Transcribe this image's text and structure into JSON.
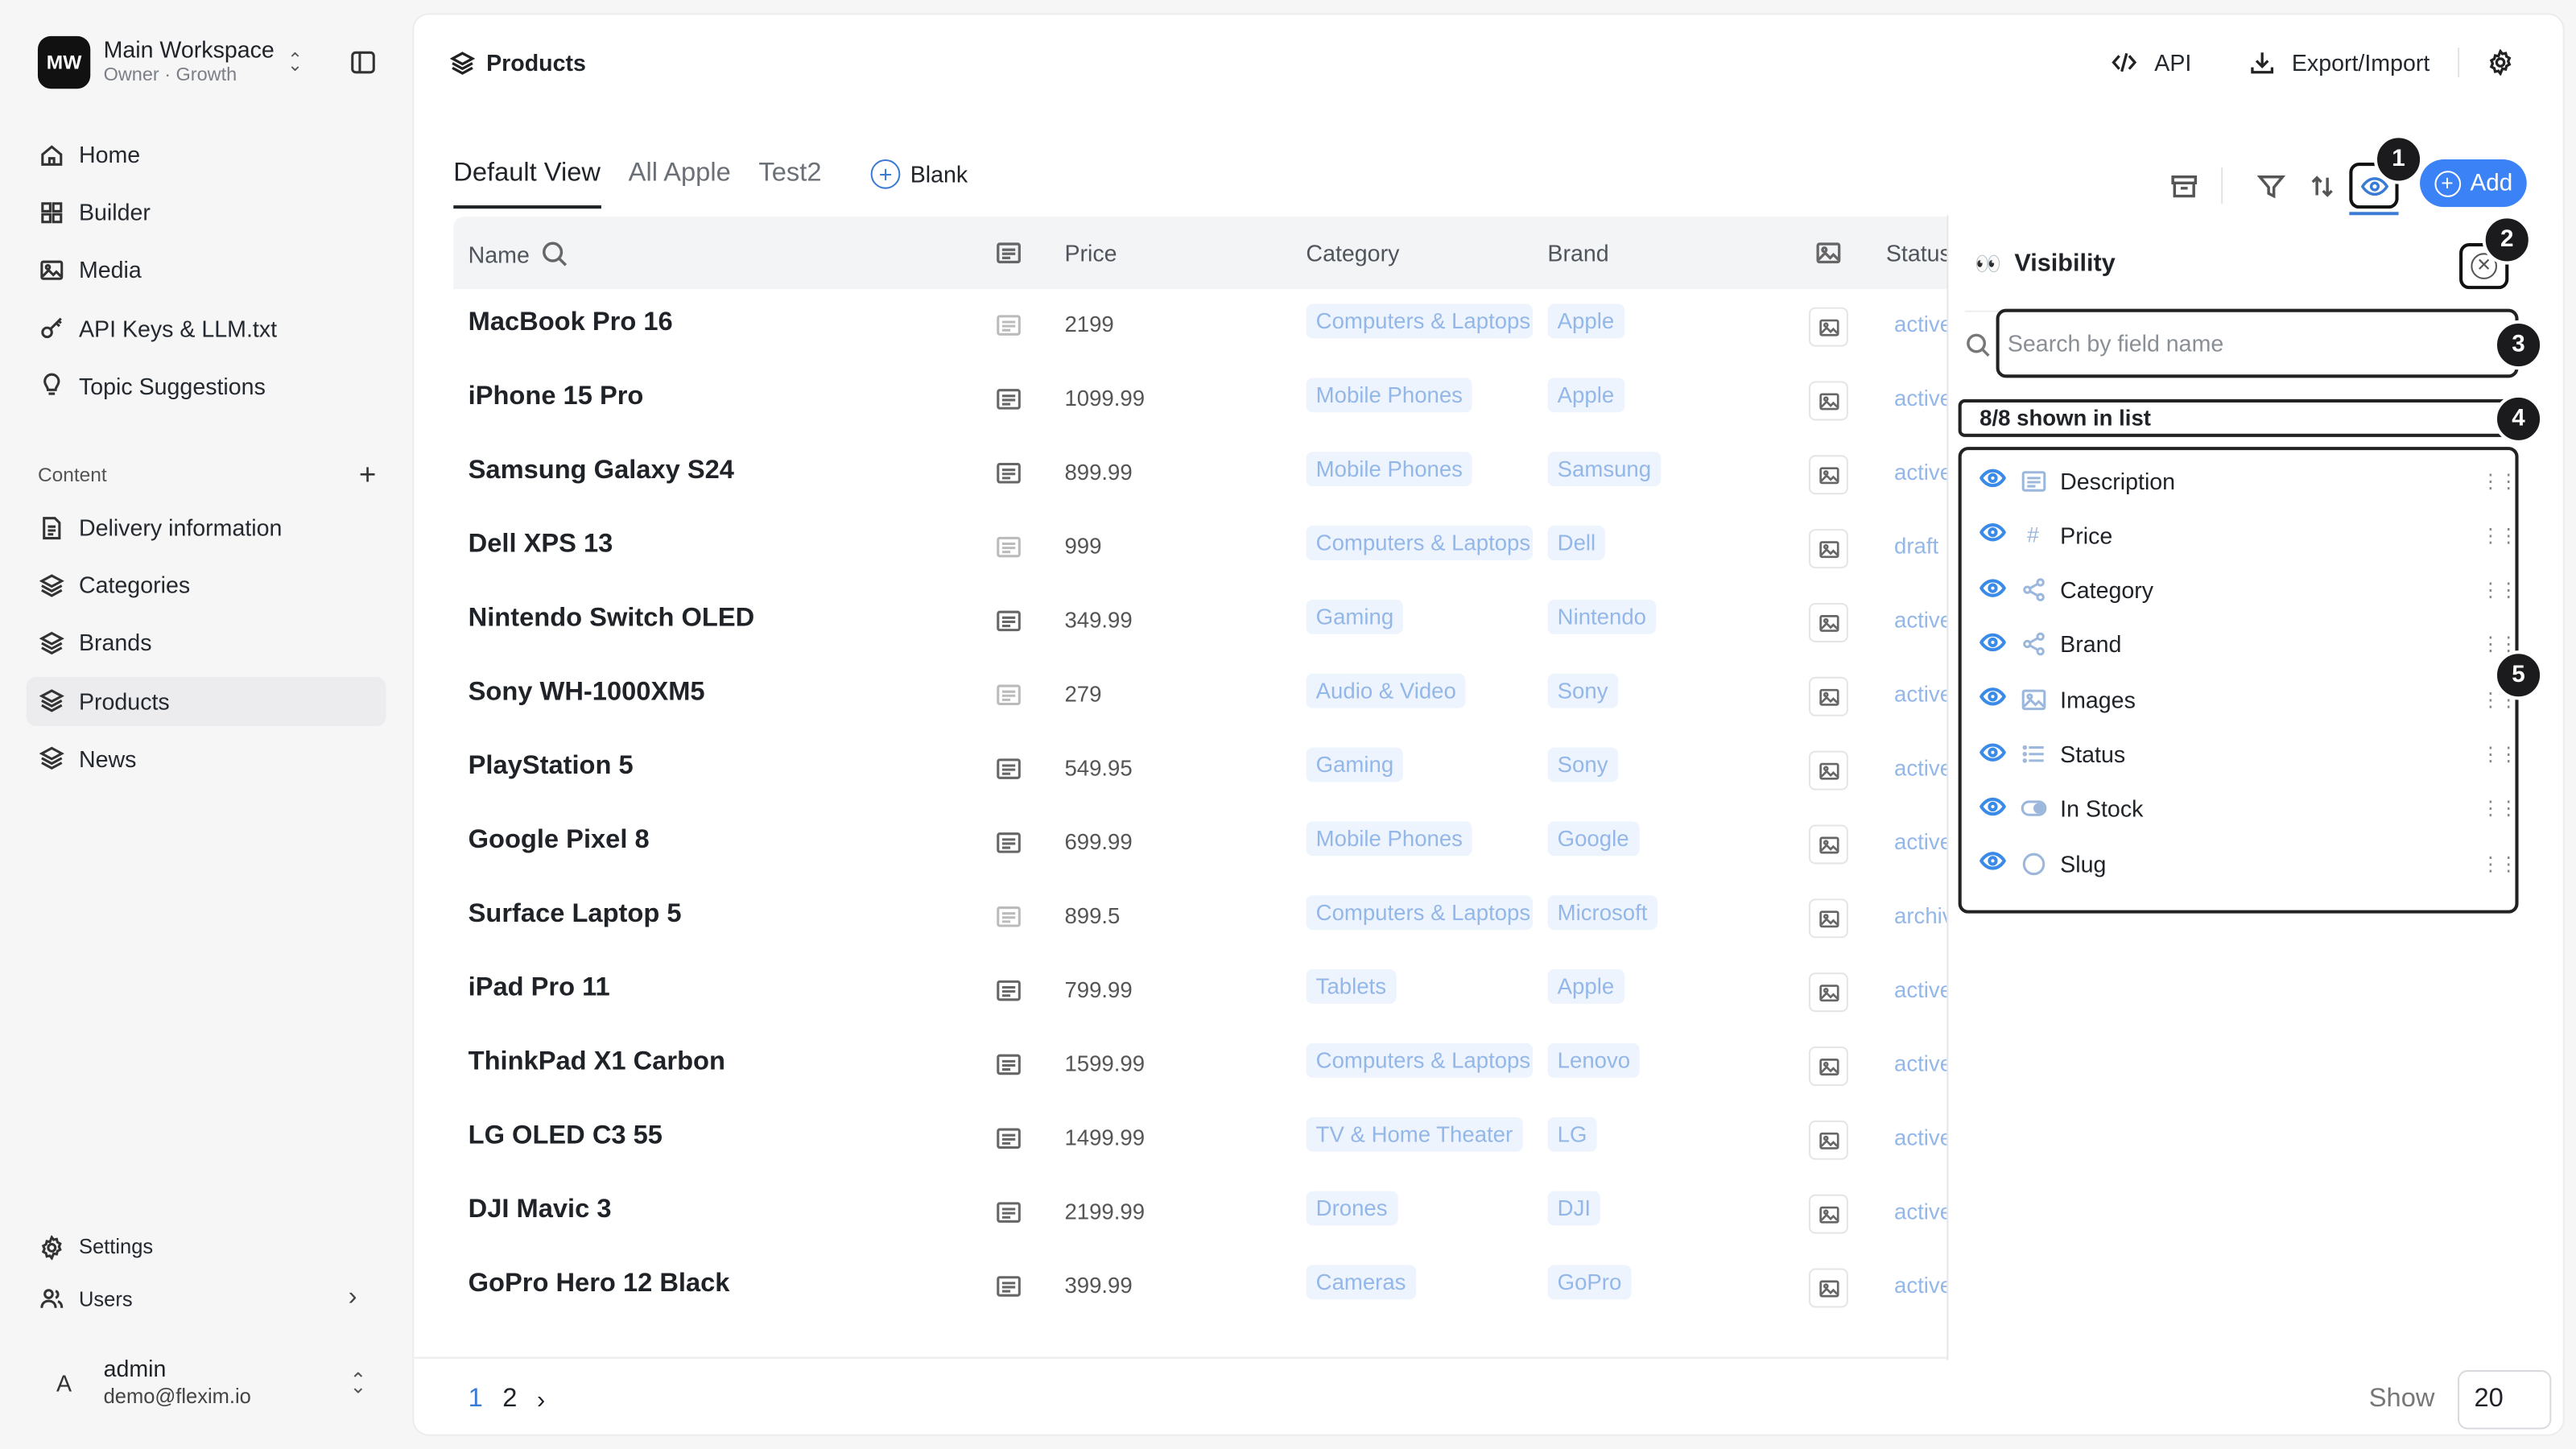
{
  "workspace": {
    "initials": "MW",
    "name": "Main Workspace",
    "role": "Owner · Growth"
  },
  "sidebar": {
    "items": [
      {
        "label": "Home",
        "icon": "home-icon"
      },
      {
        "label": "Builder",
        "icon": "grid-icon"
      },
      {
        "label": "Media",
        "icon": "image-icon"
      },
      {
        "label": "API Keys & LLM.txt",
        "icon": "key-icon"
      },
      {
        "label": "Topic Suggestions",
        "icon": "lightbulb-icon"
      }
    ],
    "content_label": "Content",
    "content_items": [
      {
        "label": "Delivery information",
        "icon": "document-icon",
        "active": false
      },
      {
        "label": "Categories",
        "icon": "layers-icon",
        "active": false
      },
      {
        "label": "Brands",
        "icon": "layers-icon",
        "active": false
      },
      {
        "label": "Products",
        "icon": "layers-icon",
        "active": true
      },
      {
        "label": "News",
        "icon": "layers-icon",
        "active": false
      }
    ],
    "bottom": [
      {
        "label": "Settings",
        "icon": "gear-icon"
      },
      {
        "label": "Users",
        "icon": "users-icon"
      }
    ],
    "user": {
      "initial": "A",
      "name": "admin",
      "email": "demo@flexim.io"
    }
  },
  "header": {
    "title": "Products",
    "api_label": "API",
    "export_label": "Export/Import"
  },
  "tabs": {
    "items": [
      "Default View",
      "All Apple",
      "Test2"
    ],
    "active": 0,
    "blank_label": "Blank",
    "add_label": "Add"
  },
  "badges": [
    "1",
    "2",
    "3",
    "4",
    "5"
  ],
  "table": {
    "columns": {
      "name": "Name",
      "price": "Price",
      "category": "Category",
      "brand": "Brand",
      "status": "Status"
    },
    "rows": [
      {
        "name": "MacBook Pro 16",
        "price": "2199",
        "category": "Computers & Laptops",
        "brand": "Apple",
        "status": "active",
        "desc": false
      },
      {
        "name": "iPhone 15 Pro",
        "price": "1099.99",
        "category": "Mobile Phones",
        "brand": "Apple",
        "status": "active",
        "desc": true
      },
      {
        "name": "Samsung Galaxy S24",
        "price": "899.99",
        "category": "Mobile Phones",
        "brand": "Samsung",
        "status": "active",
        "desc": true
      },
      {
        "name": "Dell XPS 13",
        "price": "999",
        "category": "Computers & Laptops",
        "brand": "Dell",
        "status": "draft",
        "desc": false
      },
      {
        "name": "Nintendo Switch OLED",
        "price": "349.99",
        "category": "Gaming",
        "brand": "Nintendo",
        "status": "active",
        "desc": true
      },
      {
        "name": "Sony WH-1000XM5",
        "price": "279",
        "category": "Audio & Video",
        "brand": "Sony",
        "status": "active",
        "desc": false
      },
      {
        "name": "PlayStation 5",
        "price": "549.95",
        "category": "Gaming",
        "brand": "Sony",
        "status": "active",
        "desc": true
      },
      {
        "name": "Google Pixel 8",
        "price": "699.99",
        "category": "Mobile Phones",
        "brand": "Google",
        "status": "active",
        "desc": true
      },
      {
        "name": "Surface Laptop 5",
        "price": "899.5",
        "category": "Computers & Laptops",
        "brand": "Microsoft",
        "status": "archived",
        "desc": false
      },
      {
        "name": "iPad Pro 11",
        "price": "799.99",
        "category": "Tablets",
        "brand": "Apple",
        "status": "active",
        "desc": true
      },
      {
        "name": "ThinkPad X1 Carbon",
        "price": "1599.99",
        "category": "Computers & Laptops",
        "brand": "Lenovo",
        "status": "active",
        "desc": true
      },
      {
        "name": "LG OLED C3 55",
        "price": "1499.99",
        "category": "TV & Home Theater",
        "brand": "LG",
        "status": "active",
        "desc": true
      },
      {
        "name": "DJI Mavic 3",
        "price": "2199.99",
        "category": "Drones",
        "brand": "DJI",
        "status": "active",
        "desc": true
      },
      {
        "name": "GoPro Hero 12 Black",
        "price": "399.99",
        "category": "Cameras",
        "brand": "GoPro",
        "status": "active",
        "desc": true
      }
    ]
  },
  "visibility": {
    "title": "Visibility",
    "search_placeholder": "Search by field name",
    "count_label": "8/8 shown in list",
    "fields": [
      {
        "label": "Description",
        "type_icon": "text-icon"
      },
      {
        "label": "Price",
        "type_icon": "hash-icon"
      },
      {
        "label": "Category",
        "type_icon": "relation-icon"
      },
      {
        "label": "Brand",
        "type_icon": "relation-icon"
      },
      {
        "label": "Images",
        "type_icon": "image-icon"
      },
      {
        "label": "Status",
        "type_icon": "list-icon"
      },
      {
        "label": "In Stock",
        "type_icon": "toggle-icon"
      },
      {
        "label": "Slug",
        "type_icon": "circle-icon"
      }
    ]
  },
  "footer": {
    "pages": [
      "1",
      "2"
    ],
    "current_page": "1",
    "next": "›",
    "show_label": "Show",
    "page_size": "20"
  },
  "colors": {
    "accent": "#3b82f6",
    "chip_bg": "#eef4fd",
    "chip_text": "#93b7e8"
  }
}
